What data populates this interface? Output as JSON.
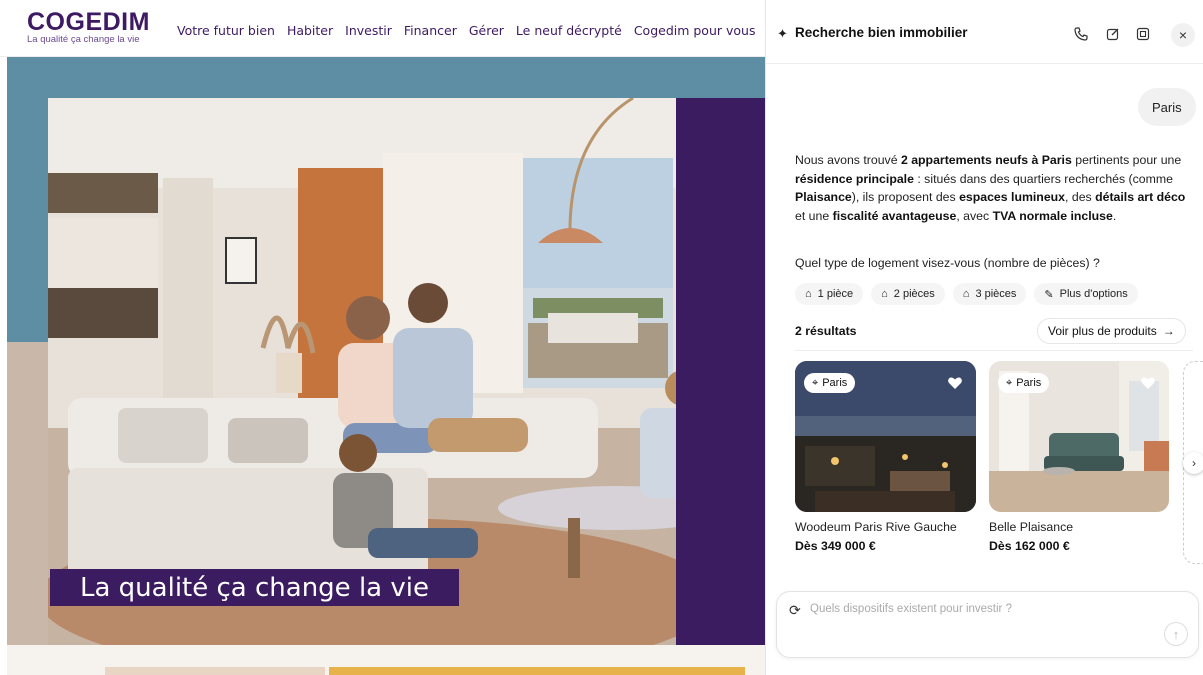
{
  "site": {
    "logo": {
      "name": "COGEDIM",
      "tagline": "La qualité ça change la vie"
    },
    "nav": [
      "Votre futur bien",
      "Habiter",
      "Investir",
      "Financer",
      "Gérer",
      "Le neuf décrypté",
      "Cogedim pour vous"
    ],
    "hero_caption": "La qualité ça change la vie"
  },
  "panel": {
    "title": "Recherche bien immobilier",
    "header_icons": [
      "phone-icon",
      "edit-icon",
      "expand-icon",
      "close-icon"
    ],
    "user_message": "Paris",
    "answer": {
      "p1": "Nous avons trouvé ",
      "b1": "2 appartements neufs à Paris",
      "p2": " pertinents pour une ",
      "b2": "résidence principale",
      "p3": " : situés dans des quartiers recherchés (comme ",
      "b3": "Plaisance",
      "p4": "), ils proposent des ",
      "b4": "espaces lumineux",
      "p5": ", des ",
      "b5": "détails art déco",
      "p6": " et une ",
      "b6": "fiscalité avantageuse",
      "p7": ", avec ",
      "b7": "TVA normale incluse",
      "p8": "."
    },
    "question": "Quel type de logement visez-vous (nombre de pièces) ?",
    "chips": [
      "1 pièce",
      "2 pièces",
      "3 pièces",
      "Plus d'options"
    ],
    "results_label": "2 résultats",
    "more_products": "Voir plus de produits",
    "cards": [
      {
        "location": "Paris",
        "name": "Woodeum Paris Rive Gauche",
        "price": "Dès 349 000 €"
      },
      {
        "location": "Paris",
        "name": "Belle Plaisance",
        "price": "Dès 162 000 €"
      }
    ],
    "composer_placeholder": "Quels dispositifs existent pour investir ?"
  },
  "colors": {
    "brand_purple": "#3b1c60",
    "hero_blue": "#5d8ea3"
  }
}
